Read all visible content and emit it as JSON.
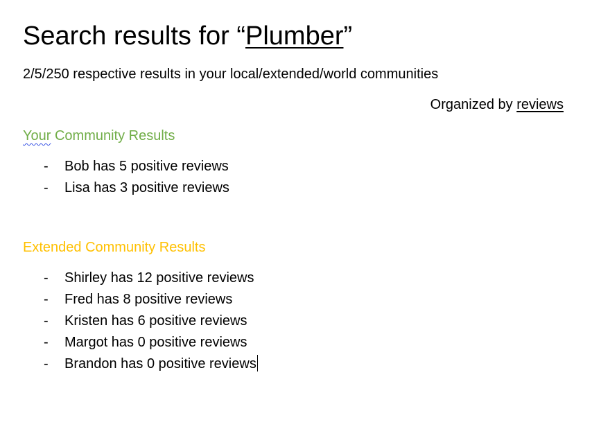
{
  "header": {
    "title_prefix": "Search results for “",
    "query": "Plumber",
    "title_suffix": "”"
  },
  "summary": "2/5/250 respective results in your local/extended/world communities",
  "sort": {
    "prefix": "Organized by",
    "key": "reviews"
  },
  "sections": {
    "local": {
      "heading_first_word": "Your",
      "heading_rest": " Community Results",
      "color": "#70ad47",
      "items": [
        "Bob has 5 positive reviews",
        "Lisa has 3 positive reviews"
      ]
    },
    "extended": {
      "heading": "Extended Community Results",
      "color": "#ffc000",
      "items": [
        "Shirley has 12 positive reviews",
        "Fred has 8 positive reviews",
        "Kristen has 6 positive reviews",
        "Margot has 0 positive reviews",
        "Brandon has 0 positive reviews"
      ]
    }
  },
  "bullet": "-"
}
